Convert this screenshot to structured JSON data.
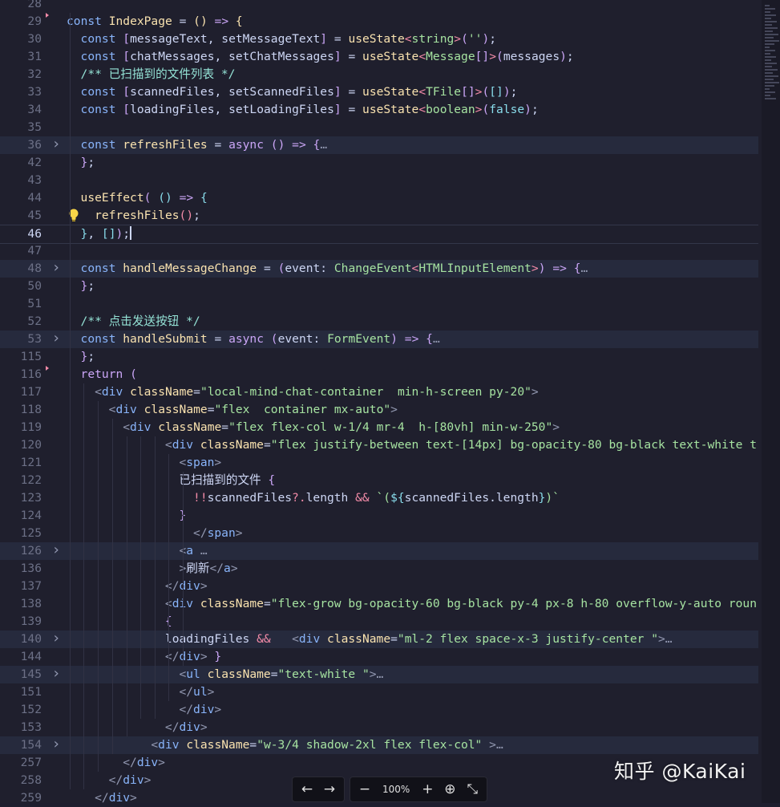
{
  "editor": {
    "lines": [
      {
        "n": "28",
        "segs": []
      },
      {
        "n": "29",
        "dot": true,
        "segs": [
          [
            "k",
            "const "
          ],
          [
            "t",
            "IndexPage"
          ],
          [
            "v",
            " = "
          ],
          [
            "b1",
            "()"
          ],
          [
            "v",
            " "
          ],
          [
            "kp",
            "=>"
          ],
          [
            "v",
            " "
          ],
          [
            "b1",
            "{"
          ]
        ]
      },
      {
        "n": "30",
        "segs": [
          [
            "k",
            "const "
          ],
          [
            "b2",
            "["
          ],
          [
            "v",
            "messageText, setMessageText"
          ],
          [
            "b2",
            "]"
          ],
          [
            "v",
            " = "
          ],
          [
            "t",
            "useState"
          ],
          [
            "p",
            "<"
          ],
          [
            "ty",
            "string"
          ],
          [
            "p",
            ">"
          ],
          [
            "b2",
            "("
          ],
          [
            "s",
            "''"
          ],
          [
            "b2",
            ")"
          ],
          [
            "v",
            ";"
          ]
        ]
      },
      {
        "n": "31",
        "segs": [
          [
            "k",
            "const "
          ],
          [
            "b2",
            "["
          ],
          [
            "v",
            "chatMessages, setChatMessages"
          ],
          [
            "b2",
            "]"
          ],
          [
            "v",
            " = "
          ],
          [
            "t",
            "useState"
          ],
          [
            "p",
            "<"
          ],
          [
            "ty",
            "Message"
          ],
          [
            "b2",
            "[]"
          ],
          [
            "p",
            ">"
          ],
          [
            "b2",
            "("
          ],
          [
            "v",
            "messages"
          ],
          [
            "b2",
            ")"
          ],
          [
            "v",
            ";"
          ]
        ]
      },
      {
        "n": "32",
        "segs": [
          [
            "c-green",
            "/** 已扫描到的文件列表 */"
          ]
        ]
      },
      {
        "n": "33",
        "segs": [
          [
            "k",
            "const "
          ],
          [
            "b2",
            "["
          ],
          [
            "v",
            "scannedFiles, setScannedFiles"
          ],
          [
            "b2",
            "]"
          ],
          [
            "v",
            " = "
          ],
          [
            "t",
            "useState"
          ],
          [
            "p",
            "<"
          ],
          [
            "ty",
            "TFile"
          ],
          [
            "b2",
            "[]"
          ],
          [
            "p",
            ">"
          ],
          [
            "b2",
            "("
          ],
          [
            "b3",
            "[]"
          ],
          [
            "b2",
            ")"
          ],
          [
            "v",
            ";"
          ]
        ]
      },
      {
        "n": "34",
        "segs": [
          [
            "k",
            "const "
          ],
          [
            "b2",
            "["
          ],
          [
            "v",
            "loadingFiles, setLoadingFiles"
          ],
          [
            "b2",
            "]"
          ],
          [
            "v",
            " = "
          ],
          [
            "t",
            "useState"
          ],
          [
            "p",
            "<"
          ],
          [
            "ty",
            "boolean"
          ],
          [
            "p",
            ">"
          ],
          [
            "b2",
            "("
          ],
          [
            "o",
            "false"
          ],
          [
            "b2",
            ")"
          ],
          [
            "v",
            ";"
          ]
        ]
      },
      {
        "n": "35",
        "segs": []
      },
      {
        "n": "36",
        "fold": true,
        "hl": true,
        "segs": [
          [
            "k",
            "const "
          ],
          [
            "t",
            "refreshFiles"
          ],
          [
            "v",
            " = "
          ],
          [
            "kp",
            "async"
          ],
          [
            "v",
            " "
          ],
          [
            "b2",
            "()"
          ],
          [
            "v",
            " "
          ],
          [
            "kp",
            "=>"
          ],
          [
            "v",
            " "
          ],
          [
            "b2",
            "{"
          ],
          [
            "pun",
            "…"
          ]
        ]
      },
      {
        "n": "42",
        "segs": [
          [
            "b2",
            "}"
          ],
          [
            "v",
            ";"
          ]
        ]
      },
      {
        "n": "43",
        "segs": []
      },
      {
        "n": "44",
        "segs": [
          [
            "t",
            "useEffect"
          ],
          [
            "b2",
            "("
          ],
          [
            "v",
            " "
          ],
          [
            "b3",
            "()"
          ],
          [
            "v",
            " "
          ],
          [
            "kp",
            "=>"
          ],
          [
            "v",
            " "
          ],
          [
            "b3",
            "{"
          ]
        ]
      },
      {
        "n": "45",
        "bulb": true,
        "segs": [
          [
            "t",
            "refreshFiles"
          ],
          [
            "p",
            "()"
          ],
          [
            "v",
            ";"
          ]
        ]
      },
      {
        "n": "46",
        "cur": true,
        "segs": [
          [
            "b3",
            "}"
          ],
          [
            "v",
            ", "
          ],
          [
            "b3",
            "[]"
          ],
          [
            "b2",
            ")"
          ],
          [
            "v",
            ";"
          ]
        ]
      },
      {
        "n": "47",
        "segs": []
      },
      {
        "n": "48",
        "fold": true,
        "hl": true,
        "segs": [
          [
            "k",
            "const "
          ],
          [
            "t",
            "handleMessageChange"
          ],
          [
            "v",
            " = "
          ],
          [
            "b2",
            "("
          ],
          [
            "v",
            "event: "
          ],
          [
            "ty",
            "ChangeEvent"
          ],
          [
            "p",
            "<"
          ],
          [
            "ty",
            "HTMLInputElement"
          ],
          [
            "p",
            ">"
          ],
          [
            "b2",
            ")"
          ],
          [
            "v",
            " "
          ],
          [
            "kp",
            "=>"
          ],
          [
            "v",
            " "
          ],
          [
            "b2",
            "{"
          ],
          [
            "pun",
            "…"
          ]
        ]
      },
      {
        "n": "50",
        "segs": [
          [
            "b2",
            "}"
          ],
          [
            "v",
            ";"
          ]
        ]
      },
      {
        "n": "51",
        "segs": []
      },
      {
        "n": "52",
        "segs": [
          [
            "c-green",
            "/** 点击发送按钮 */"
          ]
        ]
      },
      {
        "n": "53",
        "fold": true,
        "hl": true,
        "segs": [
          [
            "k",
            "const "
          ],
          [
            "t",
            "handleSubmit"
          ],
          [
            "v",
            " = "
          ],
          [
            "kp",
            "async"
          ],
          [
            "v",
            " "
          ],
          [
            "b2",
            "("
          ],
          [
            "v",
            "event: "
          ],
          [
            "ty",
            "FormEvent"
          ],
          [
            "b2",
            ")"
          ],
          [
            "v",
            " "
          ],
          [
            "kp",
            "=>"
          ],
          [
            "v",
            " "
          ],
          [
            "b2",
            "{"
          ],
          [
            "pun",
            "…"
          ]
        ]
      },
      {
        "n": "115",
        "segs": [
          [
            "b2",
            "}"
          ],
          [
            "v",
            ";"
          ]
        ]
      },
      {
        "n": "116",
        "dot": true,
        "segs": [
          [
            "kp",
            "return"
          ],
          [
            "v",
            " "
          ],
          [
            "b2",
            "("
          ]
        ]
      },
      {
        "n": "117",
        "segs": [
          [
            "pun",
            "<"
          ],
          [
            "tag",
            "div"
          ],
          [
            "v",
            " "
          ],
          [
            "attr",
            "className"
          ],
          [
            "v",
            "="
          ],
          [
            "str",
            "\"local-mind-chat-container  min-h-screen py-20\""
          ],
          [
            "pun",
            ">"
          ]
        ]
      },
      {
        "n": "118",
        "segs": [
          [
            "pun",
            "<"
          ],
          [
            "tag",
            "div"
          ],
          [
            "v",
            " "
          ],
          [
            "attr",
            "className"
          ],
          [
            "v",
            "="
          ],
          [
            "str",
            "\"flex  container mx-auto\""
          ],
          [
            "pun",
            ">"
          ]
        ]
      },
      {
        "n": "119",
        "segs": [
          [
            "pun",
            "<"
          ],
          [
            "tag",
            "div"
          ],
          [
            "v",
            " "
          ],
          [
            "attr",
            "className"
          ],
          [
            "v",
            "="
          ],
          [
            "str",
            "\"flex flex-col w-1/4 mr-4  h-[80vh] min-w-250\""
          ],
          [
            "pun",
            ">"
          ]
        ]
      },
      {
        "n": "120",
        "segs": [
          [
            "pun",
            "<"
          ],
          [
            "tag",
            "div"
          ],
          [
            "v",
            " "
          ],
          [
            "attr",
            "className"
          ],
          [
            "v",
            "="
          ],
          [
            "str",
            "\"flex justify-between text-[14px] bg-opacity-80 bg-black text-white t"
          ]
        ]
      },
      {
        "n": "121",
        "segs": [
          [
            "pun",
            "<"
          ],
          [
            "tag",
            "span"
          ],
          [
            "pun",
            ">"
          ]
        ]
      },
      {
        "n": "122",
        "segs": [
          [
            "v",
            "已扫描到的文件 "
          ],
          [
            "b2",
            "{"
          ]
        ]
      },
      {
        "n": "123",
        "segs": [
          [
            "p",
            "!!"
          ],
          [
            "v",
            "scannedFiles"
          ],
          [
            "p",
            "?."
          ],
          [
            "v",
            "length "
          ],
          [
            "p",
            "&&"
          ],
          [
            "v",
            " "
          ],
          [
            "str",
            "`("
          ],
          [
            "b3",
            "${"
          ],
          [
            "v",
            "scannedFiles.length"
          ],
          [
            "b3",
            "}"
          ],
          [
            "str",
            ")`"
          ]
        ]
      },
      {
        "n": "124",
        "segs": [
          [
            "b2",
            "}"
          ]
        ]
      },
      {
        "n": "125",
        "segs": [
          [
            "pun",
            "</"
          ],
          [
            "tag",
            "span"
          ],
          [
            "pun",
            ">"
          ]
        ]
      },
      {
        "n": "126",
        "fold": true,
        "hl": true,
        "segs": [
          [
            "pun",
            "<"
          ],
          [
            "tag",
            "a"
          ],
          [
            "v",
            " "
          ],
          [
            "pun",
            "…"
          ]
        ]
      },
      {
        "n": "136",
        "segs": [
          [
            "pun",
            ">"
          ],
          [
            "v",
            "刷新"
          ],
          [
            "pun",
            "</"
          ],
          [
            "tag",
            "a"
          ],
          [
            "pun",
            ">"
          ]
        ]
      },
      {
        "n": "137",
        "segs": [
          [
            "pun",
            "</"
          ],
          [
            "tag",
            "div"
          ],
          [
            "pun",
            ">"
          ]
        ]
      },
      {
        "n": "138",
        "segs": [
          [
            "pun",
            "<"
          ],
          [
            "tag",
            "div"
          ],
          [
            "v",
            " "
          ],
          [
            "attr",
            "className"
          ],
          [
            "v",
            "="
          ],
          [
            "str",
            "\"flex-grow bg-opacity-60 bg-black py-4 px-8 h-80 overflow-y-auto roun"
          ]
        ]
      },
      {
        "n": "139",
        "segs": [
          [
            "b2",
            "{"
          ]
        ]
      },
      {
        "n": "140",
        "fold": true,
        "hl": true,
        "segs": [
          [
            "v",
            "loadingFiles "
          ],
          [
            "p",
            "&&"
          ],
          [
            "v",
            "   "
          ],
          [
            "pun",
            "<"
          ],
          [
            "tag",
            "div"
          ],
          [
            "v",
            " "
          ],
          [
            "attr",
            "className"
          ],
          [
            "v",
            "="
          ],
          [
            "str",
            "\"ml-2 flex space-x-3 justify-center \""
          ],
          [
            "pun",
            ">"
          ],
          [
            "pun",
            "…"
          ]
        ]
      },
      {
        "n": "144",
        "segs": [
          [
            "pun",
            "</"
          ],
          [
            "tag",
            "div"
          ],
          [
            "pun",
            "> "
          ],
          [
            "b2",
            "}"
          ]
        ]
      },
      {
        "n": "145",
        "fold": true,
        "hl": true,
        "segs": [
          [
            "pun",
            "<"
          ],
          [
            "tag",
            "ul"
          ],
          [
            "v",
            " "
          ],
          [
            "attr",
            "className"
          ],
          [
            "v",
            "="
          ],
          [
            "str",
            "\"text-white \""
          ],
          [
            "pun",
            ">"
          ],
          [
            "pun",
            "…"
          ]
        ]
      },
      {
        "n": "151",
        "segs": [
          [
            "pun",
            "</"
          ],
          [
            "tag",
            "ul"
          ],
          [
            "pun",
            ">"
          ]
        ]
      },
      {
        "n": "152",
        "segs": [
          [
            "pun",
            "</"
          ],
          [
            "tag",
            "div"
          ],
          [
            "pun",
            ">"
          ]
        ]
      },
      {
        "n": "153",
        "segs": [
          [
            "pun",
            "</"
          ],
          [
            "tag",
            "div"
          ],
          [
            "pun",
            ">"
          ]
        ]
      },
      {
        "n": "154",
        "fold": true,
        "hl": true,
        "segs": [
          [
            "pun",
            "<"
          ],
          [
            "tag",
            "div"
          ],
          [
            "v",
            " "
          ],
          [
            "attr",
            "className"
          ],
          [
            "v",
            "="
          ],
          [
            "str",
            "\"w-3/4 shadow-2xl flex flex-col\""
          ],
          [
            "v",
            " "
          ],
          [
            "pun",
            ">"
          ],
          [
            "pun",
            "…"
          ]
        ]
      },
      {
        "n": "257",
        "segs": [
          [
            "pun",
            "</"
          ],
          [
            "tag",
            "div"
          ],
          [
            "pun",
            ">"
          ]
        ]
      },
      {
        "n": "258",
        "segs": [
          [
            "pun",
            "</"
          ],
          [
            "tag",
            "div"
          ],
          [
            "pun",
            ">"
          ]
        ]
      },
      {
        "n": "259",
        "segs": [
          [
            "pun",
            "</"
          ],
          [
            "tag",
            "div"
          ],
          [
            "pun",
            ">"
          ]
        ]
      }
    ]
  },
  "toolbar": {
    "back_icon": "←",
    "forward_icon": "→",
    "zoom_out_icon": "−",
    "zoom_level": "100%",
    "zoom_in_icon": "+",
    "download_icon": "⊕",
    "collapse_icon": "⤡"
  },
  "watermark": "知乎 @KaiKai"
}
